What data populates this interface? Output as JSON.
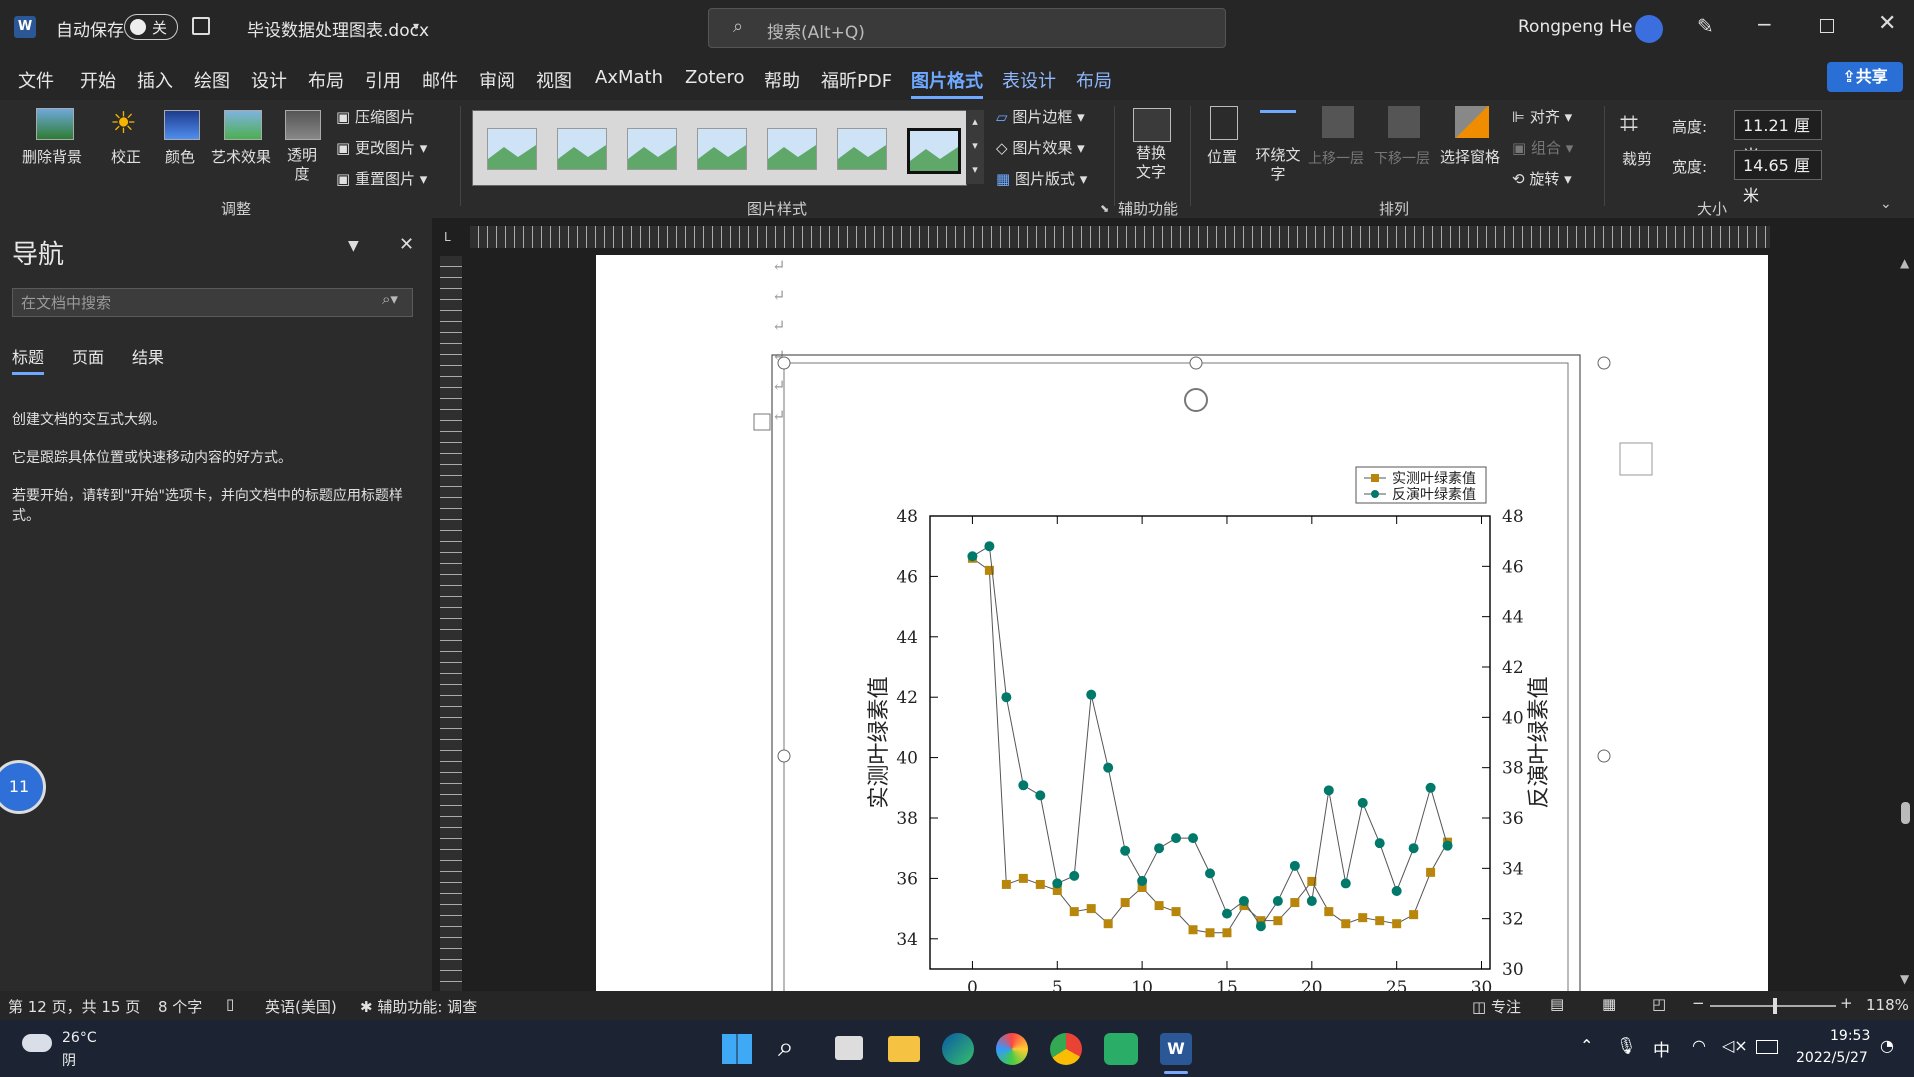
{
  "title_bar": {
    "autosave_label": "自动保存",
    "autosave_state": "关",
    "doc_name": "毕设数据处理图表.docx",
    "search_placeholder": "搜索(Alt+Q)",
    "user": "Rongpeng He"
  },
  "menu": {
    "items": [
      "文件",
      "开始",
      "插入",
      "绘图",
      "设计",
      "布局",
      "引用",
      "邮件",
      "审阅",
      "视图",
      "AxMath",
      "Zotero",
      "帮助",
      "福昕PDF"
    ],
    "active": "图片格式",
    "context_items": [
      "表设计",
      "布局"
    ],
    "share": "共享"
  },
  "ribbon": {
    "adjust": {
      "remove_bg": "删除背景",
      "correct": "校正",
      "color": "颜色",
      "art": "艺术效果",
      "transparency": "透明度",
      "compress": "压缩图片",
      "change": "更改图片",
      "reset": "重置图片",
      "group_label": "调整"
    },
    "styles": {
      "border": "图片边框",
      "effects": "图片效果",
      "layout": "图片版式",
      "group_label": "图片样式"
    },
    "accessibility": {
      "alt_text": "替换文字",
      "group_label": "辅助功能"
    },
    "arrange": {
      "position": "位置",
      "wrap": "环绕文字",
      "forward": "上移一层",
      "backward": "下移一层",
      "selection_pane": "选择窗格",
      "align": "对齐",
      "group": "组合",
      "rotate": "旋转",
      "group_label": "排列"
    },
    "size": {
      "crop": "裁剪",
      "height_label": "高度:",
      "height_value": "11.21 厘米",
      "width_label": "宽度:",
      "width_value": "14.65 厘米",
      "group_label": "大小"
    }
  },
  "nav": {
    "title": "导航",
    "search_placeholder": "在文档中搜索",
    "tabs": [
      "标题",
      "页面",
      "结果"
    ],
    "hint1": "创建文档的交互式大纲。",
    "hint2": "它是跟踪具体位置或快速移动内容的好方式。",
    "hint3": "若要开始，请转到\"开始\"选项卡，并向文档中的标题应用标题样式。"
  },
  "badge_number": "11",
  "status": {
    "page": "第 12 页，共 15 页",
    "words": "8 个字",
    "language": "英语(美国)",
    "accessibility": "辅助功能: 调查",
    "focus": "专注",
    "zoom": "118%"
  },
  "taskbar": {
    "temp": "26°C",
    "weather": "阴",
    "ime": "中",
    "time": "19:53",
    "date": "2022/5/27"
  },
  "colors": {
    "series1": "#b8860b",
    "series2": "#00796b",
    "accent": "#2a6fd6"
  },
  "chart_data": {
    "type": "line",
    "ylabel_left": "实测叶绿素值",
    "ylabel_right": "反演叶绿素值",
    "ylim_left": [
      33,
      48
    ],
    "ylim_right": [
      30,
      48
    ],
    "yticks_left": [
      34,
      36,
      38,
      40,
      42,
      44,
      46,
      48
    ],
    "yticks_right": [
      30,
      32,
      34,
      36,
      38,
      40,
      42,
      44,
      46,
      48
    ],
    "xticks": [
      0,
      5,
      10,
      15,
      20,
      25,
      30
    ],
    "xlim": [
      -2.5,
      30.5
    ],
    "legend_position": "top-right",
    "series": [
      {
        "name": "实测叶绿素值",
        "marker": "square",
        "axis": "left",
        "x": [
          0,
          1,
          2,
          3,
          4,
          5,
          6,
          7,
          8,
          9,
          10,
          11,
          12,
          13,
          14,
          15,
          16,
          17,
          18,
          19,
          20,
          21,
          22,
          23,
          24,
          25,
          26,
          27,
          28
        ],
        "values": [
          46.6,
          46.2,
          35.8,
          36.0,
          35.8,
          35.6,
          34.9,
          35.0,
          34.5,
          35.2,
          35.7,
          35.1,
          34.9,
          34.3,
          34.2,
          34.2,
          35.1,
          34.6,
          34.6,
          35.2,
          35.9,
          34.9,
          34.5,
          34.7,
          34.6,
          34.5,
          34.8,
          36.2,
          37.2
        ]
      },
      {
        "name": "反演叶绿素值",
        "marker": "circle",
        "axis": "right",
        "x": [
          0,
          1,
          2,
          3,
          4,
          5,
          6,
          7,
          8,
          9,
          10,
          11,
          12,
          13,
          14,
          15,
          16,
          17,
          18,
          19,
          20,
          21,
          22,
          23,
          24,
          25,
          26,
          27,
          28
        ],
        "values": [
          46.4,
          46.8,
          40.8,
          37.3,
          36.9,
          33.4,
          33.7,
          40.9,
          38.0,
          34.7,
          33.5,
          34.8,
          35.2,
          35.2,
          33.8,
          32.2,
          32.7,
          31.7,
          32.7,
          34.1,
          32.7,
          37.1,
          33.4,
          36.6,
          35.0,
          33.1,
          34.8,
          37.2,
          34.9
        ]
      }
    ]
  }
}
